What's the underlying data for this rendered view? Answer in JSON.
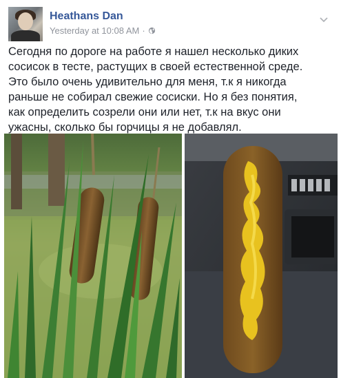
{
  "post": {
    "author_name": "Heathans Dan",
    "timestamp": "Yesterday at 10:08 AM",
    "separator": "·",
    "privacy_icon": "globe-icon",
    "menu_icon": "chevron-down-icon",
    "text_lines": [
      "Сегодня по дороге на работе я нашел несколько диких",
      "сосисок в тесте, растущих в своей естественной среде.",
      "Это было очень удивительно для меня, т.к я никогда",
      "раньше не собирал свежие сосиски. Но я без понятия,",
      "как определить созрели они или нет, т.к на вкус они",
      "ужасны, сколько бы горчицы я не добавлял."
    ]
  },
  "photos": [
    {
      "subject": "cattails"
    },
    {
      "subject": "corn-dog-with-mustard"
    }
  ],
  "colors": {
    "author": "#365899",
    "meta": "#90949c",
    "text": "#1d2129"
  }
}
